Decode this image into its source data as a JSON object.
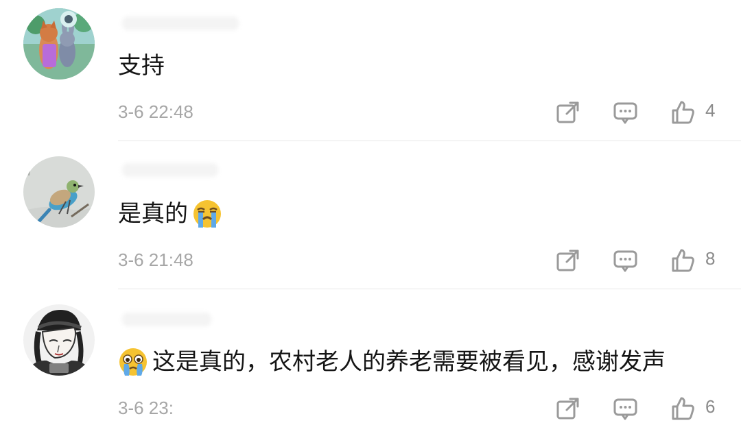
{
  "comments": [
    {
      "text": "支持",
      "time": "3-6 22:48",
      "likes": "4",
      "avatar_icon": "cartoon-fox-rabbit-avatar",
      "emoji_icon": null
    },
    {
      "text": "是真的",
      "time": "3-6 21:48",
      "likes": "8",
      "avatar_icon": "bird-on-branch-avatar",
      "emoji_icon": "crying-face-emoji"
    },
    {
      "text": "这是真的，农村老人的养老需要被看见，感谢发声",
      "time": "3-6 23:",
      "likes": "6",
      "avatar_icon": "sketch-person-avatar",
      "emoji_icon": "teary-face-emoji"
    }
  ],
  "action_icons": {
    "share": "share-icon",
    "reply": "comment-icon",
    "like": "thumbs-up-icon"
  },
  "colors": {
    "text": "#151515",
    "meta": "#a6a6a6",
    "icon": "#9a9a9a",
    "divider": "#e7e7e7"
  }
}
